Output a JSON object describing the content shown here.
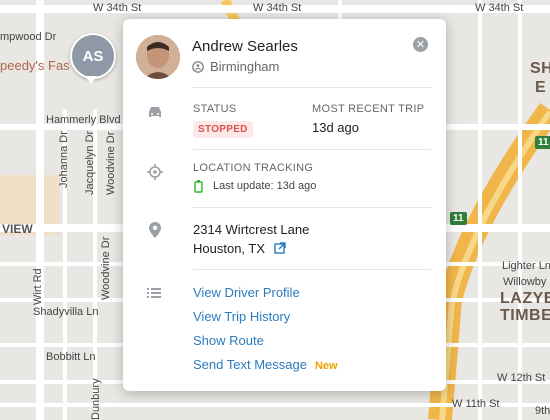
{
  "map": {
    "labels": {
      "w34a": "W 34th St",
      "w34b": "W 34th St",
      "w34c": "W 34th St",
      "hammerly": "Hammerly Blvd",
      "campwood": "mpwood Dr",
      "speedys": "peedy's Fas",
      "view": "VIEW",
      "johanna": "Johanna Dr",
      "jacquelyn": "Jacquelyn Dr",
      "woodvine_top": "Woodvine Dr",
      "woodvine_bottom": "Woodvine Dr",
      "wirt": "Wirt Rd",
      "shadyvilla": "Shadyvilla Ln",
      "bobbitt": "Bobbitt Ln",
      "dunbury": "Dunbury",
      "w12": "W 12th St",
      "w11": "W 11th St",
      "w9": "9th",
      "lighter": "Lighter Ln",
      "willowby": "Willowby Dr",
      "lazyb": "LAZYB",
      "timber": "TIMBER",
      "sh": "SH",
      "ee": "E",
      "shield1": "11",
      "shield2": "11"
    }
  },
  "pin": {
    "initials": "AS"
  },
  "driver": {
    "name": "Andrew Searles",
    "location": "Birmingham"
  },
  "status": {
    "label": "STATUS",
    "value": "STOPPED"
  },
  "trip": {
    "label": "MOST RECENT TRIP",
    "value": "13d ago"
  },
  "tracking": {
    "label": "LOCATION TRACKING",
    "last_update": "Last update: 13d ago"
  },
  "address": {
    "line1": "2314 Wirtcrest Lane",
    "line2": "Houston, TX"
  },
  "links": [
    {
      "label": "View Driver Profile"
    },
    {
      "label": "View Trip History"
    },
    {
      "label": "Show Route"
    },
    {
      "label": "Send Text Message",
      "badge": "New"
    }
  ],
  "colors": {
    "accent": "#2b7bbf",
    "stopped": "#d9534f",
    "new": "#f0a000",
    "battery": "#2eb82e"
  }
}
